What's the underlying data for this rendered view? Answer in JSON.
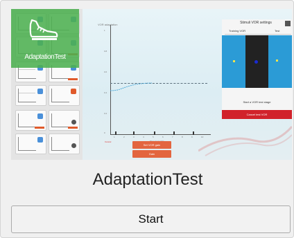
{
  "thumbnail": {
    "badge_label": "AdaptationTest",
    "plot_title": "VOR adaptation",
    "y_ticks": [
      "1",
      "0.8",
      "0.6",
      "0.4",
      "0.2",
      "0"
    ],
    "x_ticks": [
      "1",
      "2",
      "3",
      "4",
      "5",
      "6",
      "7",
      "8",
      "9",
      "10"
    ],
    "x_label": "Time (seconds)",
    "red_marker": "Cancel",
    "orange_button_1": "Set VOR gain",
    "orange_button_2": "Gain",
    "right_panel": {
      "title": "Stimuli VOR settings",
      "tab_1": "Training VOR",
      "tab_2": "Test",
      "subtitle": "Start a VOR test stage",
      "red_button": "Cancel test VOR"
    },
    "icons": [
      "sneaker-icon",
      "close-icon"
    ],
    "colors": {
      "badge_green": "#4caf50",
      "accent_blue": "#2b9bd6",
      "accent_orange": "#e3653f",
      "accent_red": "#d1222b"
    }
  },
  "title": "AdaptationTest",
  "start_label": "Start"
}
